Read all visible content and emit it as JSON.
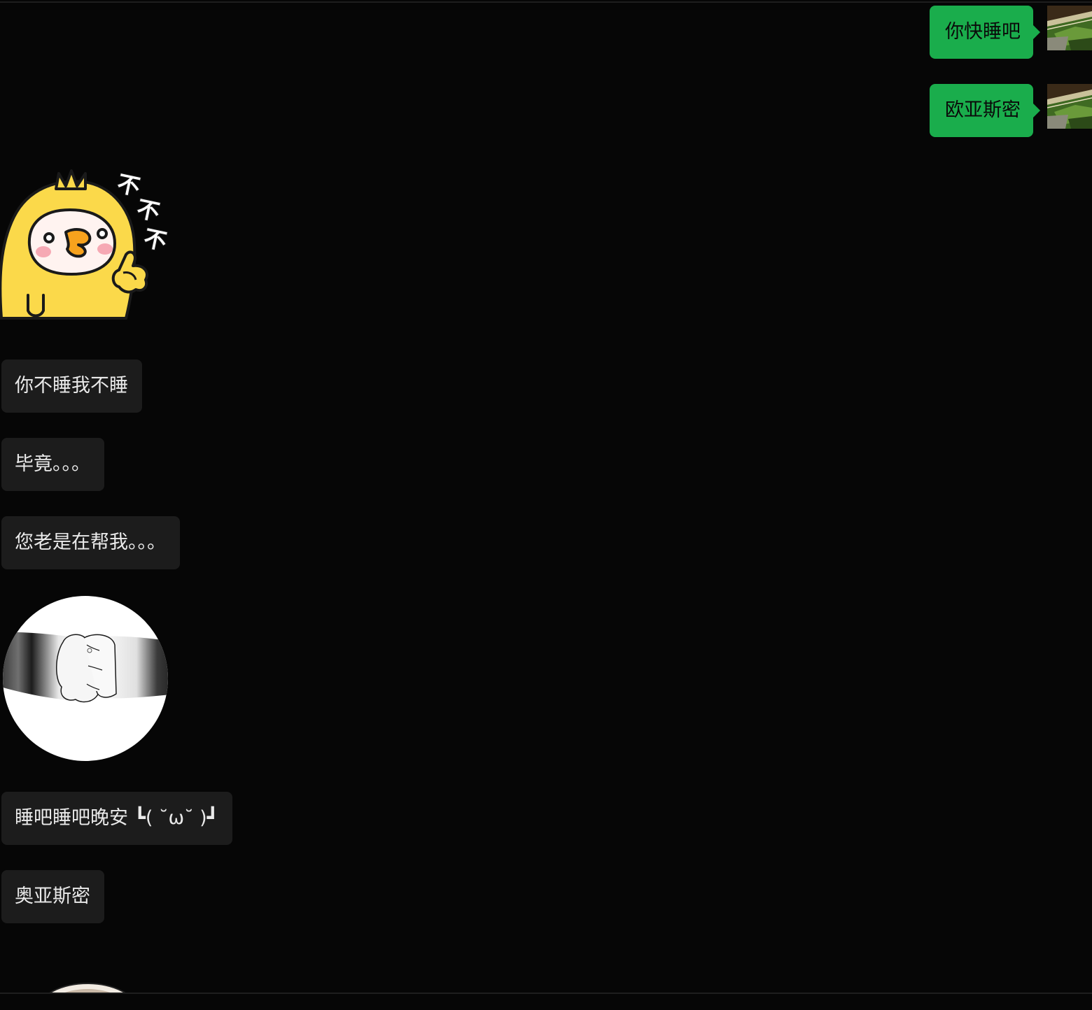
{
  "chat": {
    "messages": [
      {
        "id": "m1",
        "from": "me",
        "type": "text",
        "text": "你快睡吧"
      },
      {
        "id": "m2",
        "from": "me",
        "type": "text",
        "text": "欧亚斯密"
      },
      {
        "id": "m3",
        "from": "other",
        "type": "sticker",
        "sticker": "yellow-chick-thumbs-up",
        "caption": "不不不"
      },
      {
        "id": "m4",
        "from": "other",
        "type": "text",
        "text": "你不睡我不睡"
      },
      {
        "id": "m5",
        "from": "other",
        "type": "text",
        "text": "毕竟。。。"
      },
      {
        "id": "m6",
        "from": "other",
        "type": "text",
        "text": "您老是在帮我。。。"
      },
      {
        "id": "m7",
        "from": "other",
        "type": "sticker",
        "sticker": "paw-fist-bump"
      },
      {
        "id": "m8",
        "from": "other",
        "type": "text",
        "text": "睡吧睡吧晚安 ┗( ˘ω˘ )┛"
      },
      {
        "id": "m9",
        "from": "other",
        "type": "text",
        "text": "奥亚斯密"
      },
      {
        "id": "m10",
        "from": "other",
        "type": "sticker",
        "sticker": "partial-sticker"
      }
    ]
  },
  "theme": {
    "background": "#060606",
    "sent_bubble": "#1aad4c",
    "received_bubble": "#1c1c1c",
    "received_text": "#eaeaea",
    "sent_text": "#0a0a0a"
  }
}
